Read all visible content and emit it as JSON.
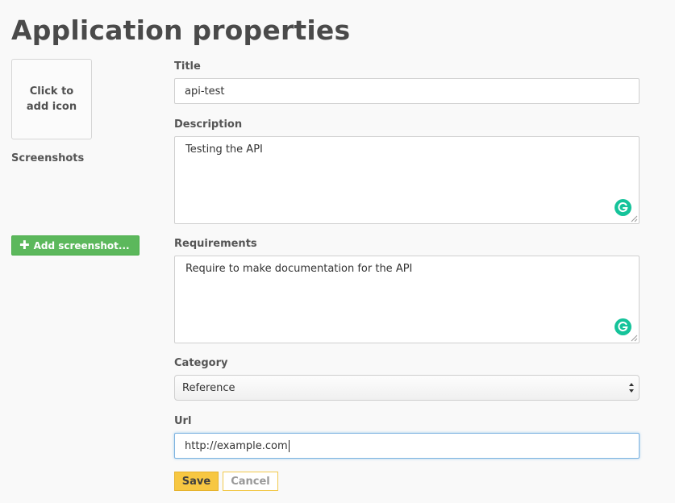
{
  "page": {
    "title": "Application properties"
  },
  "left": {
    "icon_box_label": "Click to add icon",
    "screenshots_label": "Screenshots",
    "add_screenshot_label": "Add screenshot..."
  },
  "form": {
    "title_label": "Title",
    "title_value": "api-test",
    "description_label": "Description",
    "description_value": "Testing the API",
    "requirements_label": "Requirements",
    "requirements_value": "Require to make documentation for the API",
    "category_label": "Category",
    "category_value": "Reference",
    "url_label": "Url",
    "url_value": "http://example.com"
  },
  "buttons": {
    "save_label": "Save",
    "cancel_label": "Cancel"
  },
  "colors": {
    "add_screenshot_green": "#5cb85c",
    "save_yellow": "#f7c742",
    "grammarly_green": "#15c39a",
    "focus_blue": "#7db3e0"
  },
  "icons": {
    "add_screenshot": "plus-icon",
    "grammarly": "grammarly-icon",
    "select": "select-arrows-icon",
    "resize": "resize-grip-icon"
  }
}
